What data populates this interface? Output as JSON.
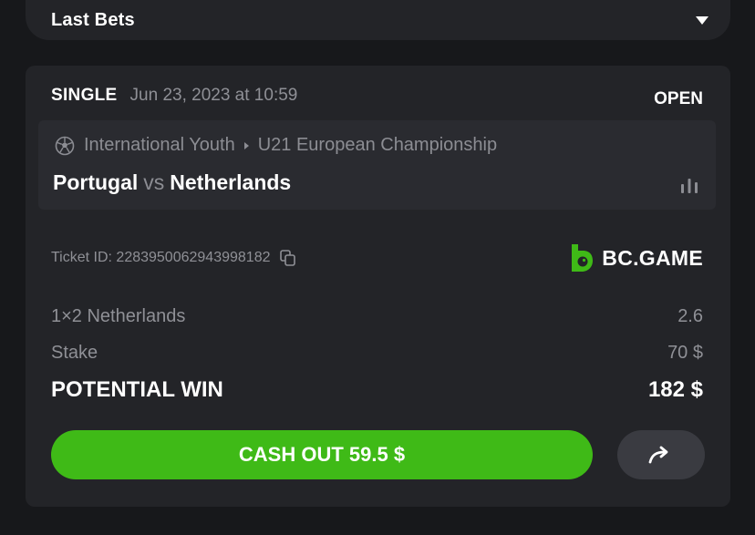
{
  "dropdown": {
    "label": "Last Bets"
  },
  "bet": {
    "type": "SINGLE",
    "date": "Jun 23, 2023 at 10:59",
    "status": "OPEN",
    "event": {
      "sport_icon": "soccer-ball-icon",
      "category": "International Youth",
      "tournament": "U21 European Championship",
      "home": "Portugal",
      "vs": "vs",
      "away": "Netherlands"
    },
    "ticket_id_text": "Ticket ID: 2283950062943998182",
    "brand": "BC.GAME",
    "selection": {
      "label": "1×2 Netherlands",
      "odds": "2.6"
    },
    "stake": {
      "label": "Stake",
      "value": "70 $"
    },
    "potential_win": {
      "label": "POTENTIAL WIN",
      "value": "182 $"
    },
    "cashout_label": "CASH OUT 59.5 $"
  },
  "colors": {
    "accent": "#3fba17",
    "card": "#232428",
    "background": "#17181b"
  }
}
